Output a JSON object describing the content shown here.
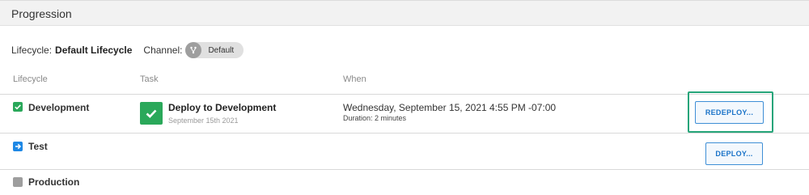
{
  "panel": {
    "title": "Progression"
  },
  "lifecycle_bar": {
    "lifecycle_label": "Lifecycle:",
    "lifecycle_value": "Default Lifecycle",
    "channel_label": "Channel:",
    "channel_value": "Default"
  },
  "columns": {
    "lifecycle": "Lifecycle",
    "task": "Task",
    "when": "When"
  },
  "phases": [
    {
      "name": "Development",
      "status": "complete",
      "task": {
        "name": "Deploy to Development",
        "date": "September 15th 2021",
        "status": "success"
      },
      "when": "Wednesday, September 15, 2021 4:55 PM -07:00",
      "duration": "Duration: 2 minutes",
      "action_label": "REDEPLOY..."
    },
    {
      "name": "Test",
      "status": "next",
      "action_label": "DEPLOY..."
    },
    {
      "name": "Production",
      "status": "pending"
    }
  ],
  "colors": {
    "success": "#2aa85a",
    "next": "#1e88e5",
    "pending": "#9e9e9e",
    "focus_ring": "#27a57a",
    "button_text": "#1a73c8"
  }
}
